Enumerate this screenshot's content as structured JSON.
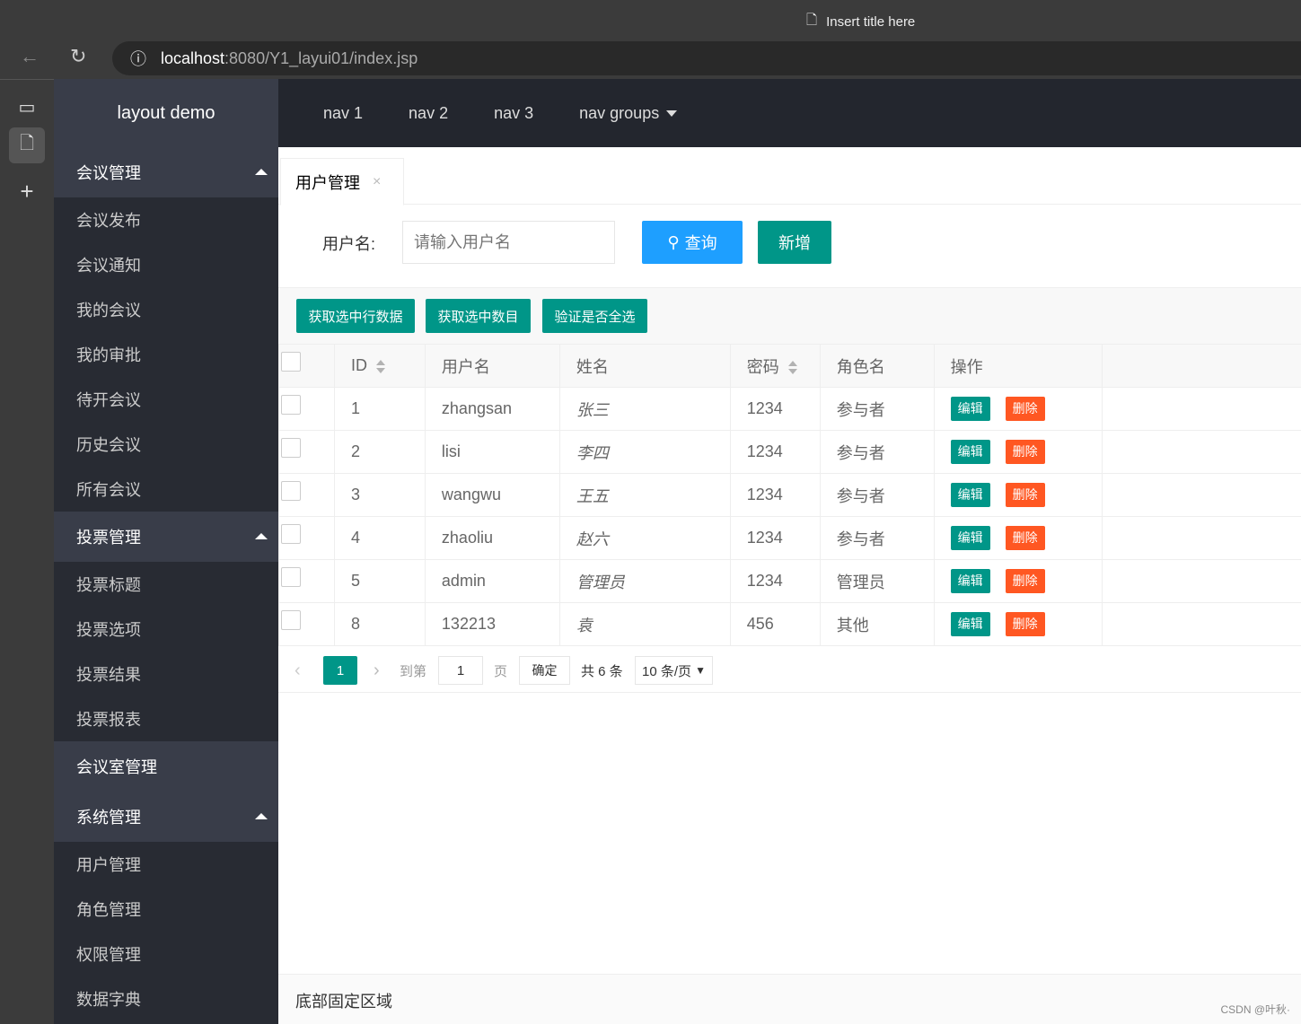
{
  "browser": {
    "title": "Insert title here",
    "url_host": "localhost",
    "url_path": ":8080/Y1_layui01/index.jsp"
  },
  "sidebar": {
    "logo": "layout demo",
    "groups": [
      {
        "label": "会议管理",
        "expanded": true,
        "items": [
          "会议发布",
          "会议通知",
          "我的会议",
          "我的审批",
          "待开会议",
          "历史会议",
          "所有会议"
        ]
      },
      {
        "label": "投票管理",
        "expanded": true,
        "items": [
          "投票标题",
          "投票选项",
          "投票结果",
          "投票报表"
        ]
      },
      {
        "label": "会议室管理",
        "expanded": false,
        "items": []
      },
      {
        "label": "系统管理",
        "expanded": true,
        "items": [
          "用户管理",
          "角色管理",
          "权限管理",
          "数据字典"
        ]
      }
    ]
  },
  "topnav": [
    "nav 1",
    "nav 2",
    "nav 3",
    "nav groups"
  ],
  "tab": {
    "label": "用户管理",
    "close": "×"
  },
  "form": {
    "label": "用户名:",
    "placeholder": "请输入用户名",
    "search": "查询",
    "add": "新增"
  },
  "toolbar": [
    "获取选中行数据",
    "获取选中数目",
    "验证是否全选"
  ],
  "table": {
    "columns": [
      "ID",
      "用户名",
      "姓名",
      "密码",
      "角色名",
      "操作"
    ],
    "rows": [
      [
        "1",
        "zhangsan",
        "张三",
        "1234",
        "参与者"
      ],
      [
        "2",
        "lisi",
        "李四",
        "1234",
        "参与者"
      ],
      [
        "3",
        "wangwu",
        "王五",
        "1234",
        "参与者"
      ],
      [
        "4",
        "zhaoliu",
        "赵六",
        "1234",
        "参与者"
      ],
      [
        "5",
        "admin",
        "管理员",
        "1234",
        "管理员"
      ],
      [
        "8",
        "132213",
        "袁",
        "456",
        "其他"
      ]
    ],
    "edit": "编辑",
    "delete": "删除"
  },
  "pager": {
    "current": "1",
    "goto": "到第",
    "page_input": "1",
    "page_unit": "页",
    "confirm": "确定",
    "total": "共 6 条",
    "per_page": "10 条/页"
  },
  "footer": "底部固定区域",
  "watermark": "CSDN @叶秋·",
  "colors": {
    "primary": "#009688",
    "search": "#1E9FFF",
    "danger": "#FF5722",
    "side": "#282B33",
    "header": "#23262E"
  }
}
